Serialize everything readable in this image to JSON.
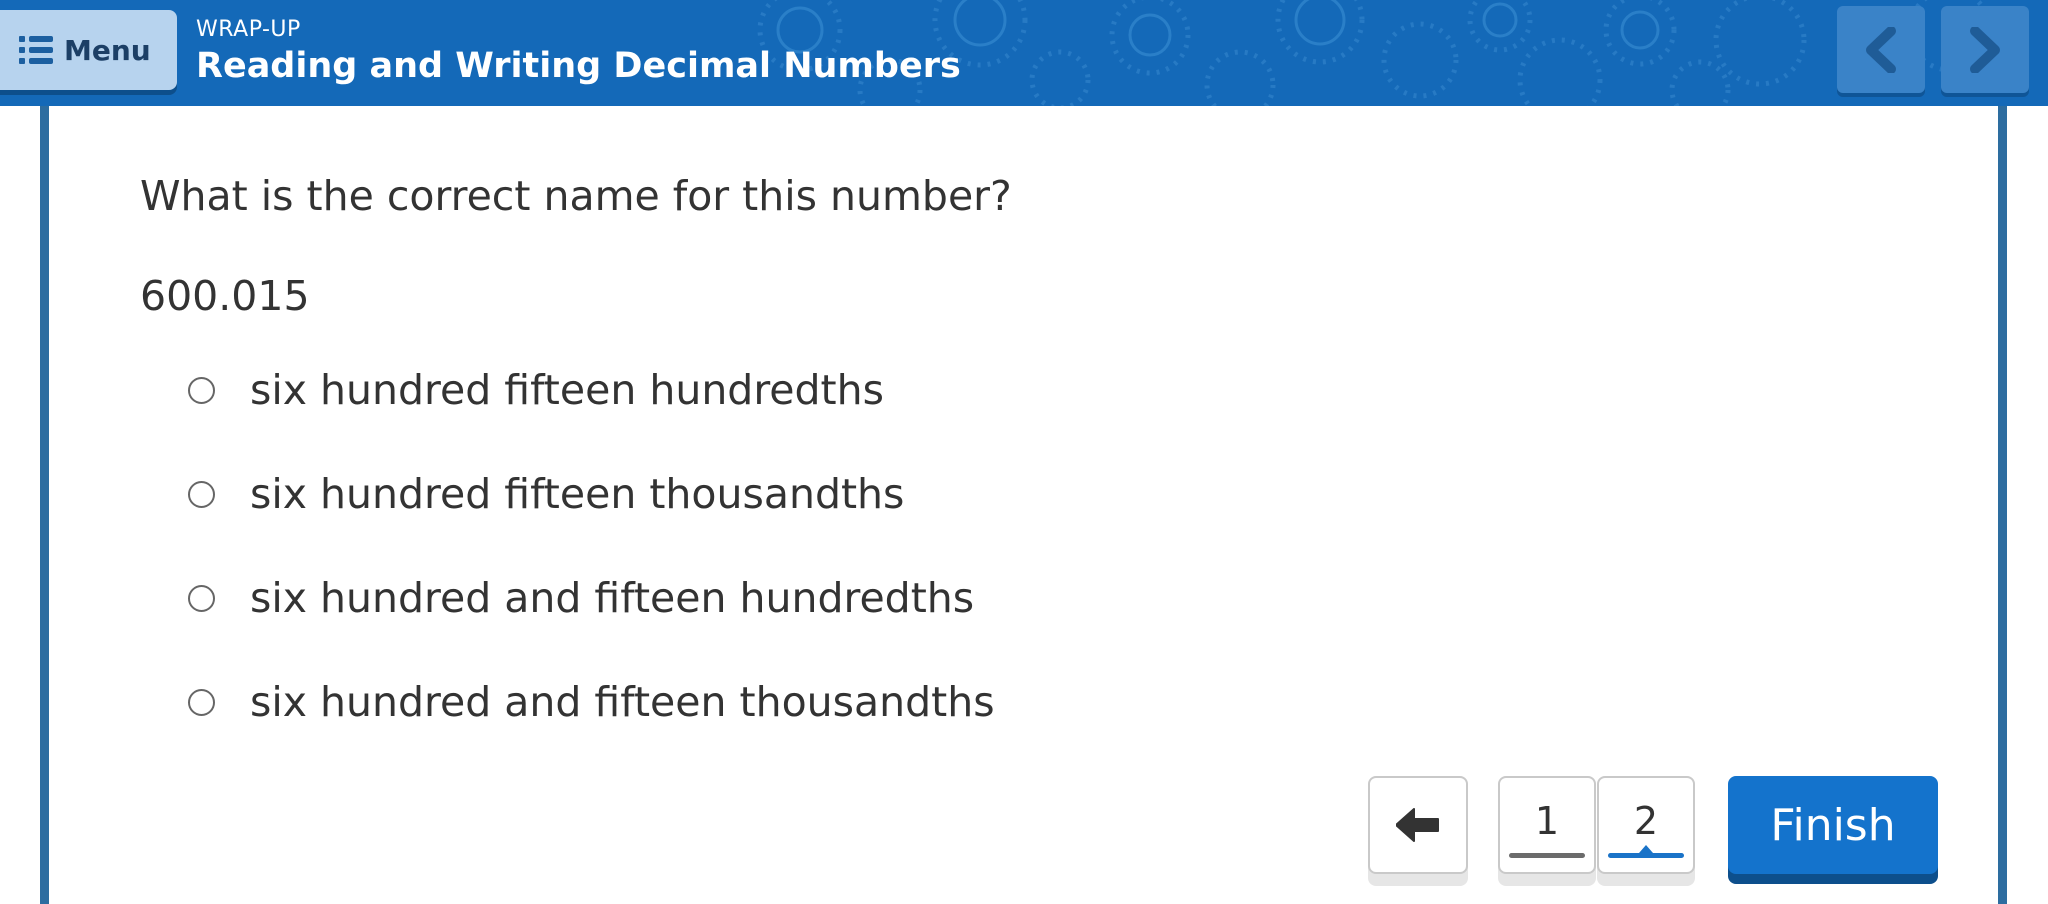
{
  "header": {
    "menu_label": "Menu",
    "supertitle": "WRAP-UP",
    "title": "Reading and Writing Decimal Numbers"
  },
  "question": {
    "prompt": "What is the correct name for this number?",
    "number": "600.015",
    "options": [
      "six hundred fifteen hundredths",
      "six hundred fifteen thousandths",
      "six hundred and fifteen hundredths",
      "six hundred and fifteen thousandths"
    ]
  },
  "footer": {
    "pages": [
      "1",
      "2"
    ],
    "current_page": "2",
    "finish_label": "Finish"
  },
  "colors": {
    "header_bg": "#1469b8",
    "accent": "#1473cc",
    "panel_border": "#2d6da0"
  },
  "icons": {
    "menu": "menu-icon",
    "prev": "chevron-left-icon",
    "next": "chevron-right-icon",
    "back": "arrow-left-icon"
  }
}
